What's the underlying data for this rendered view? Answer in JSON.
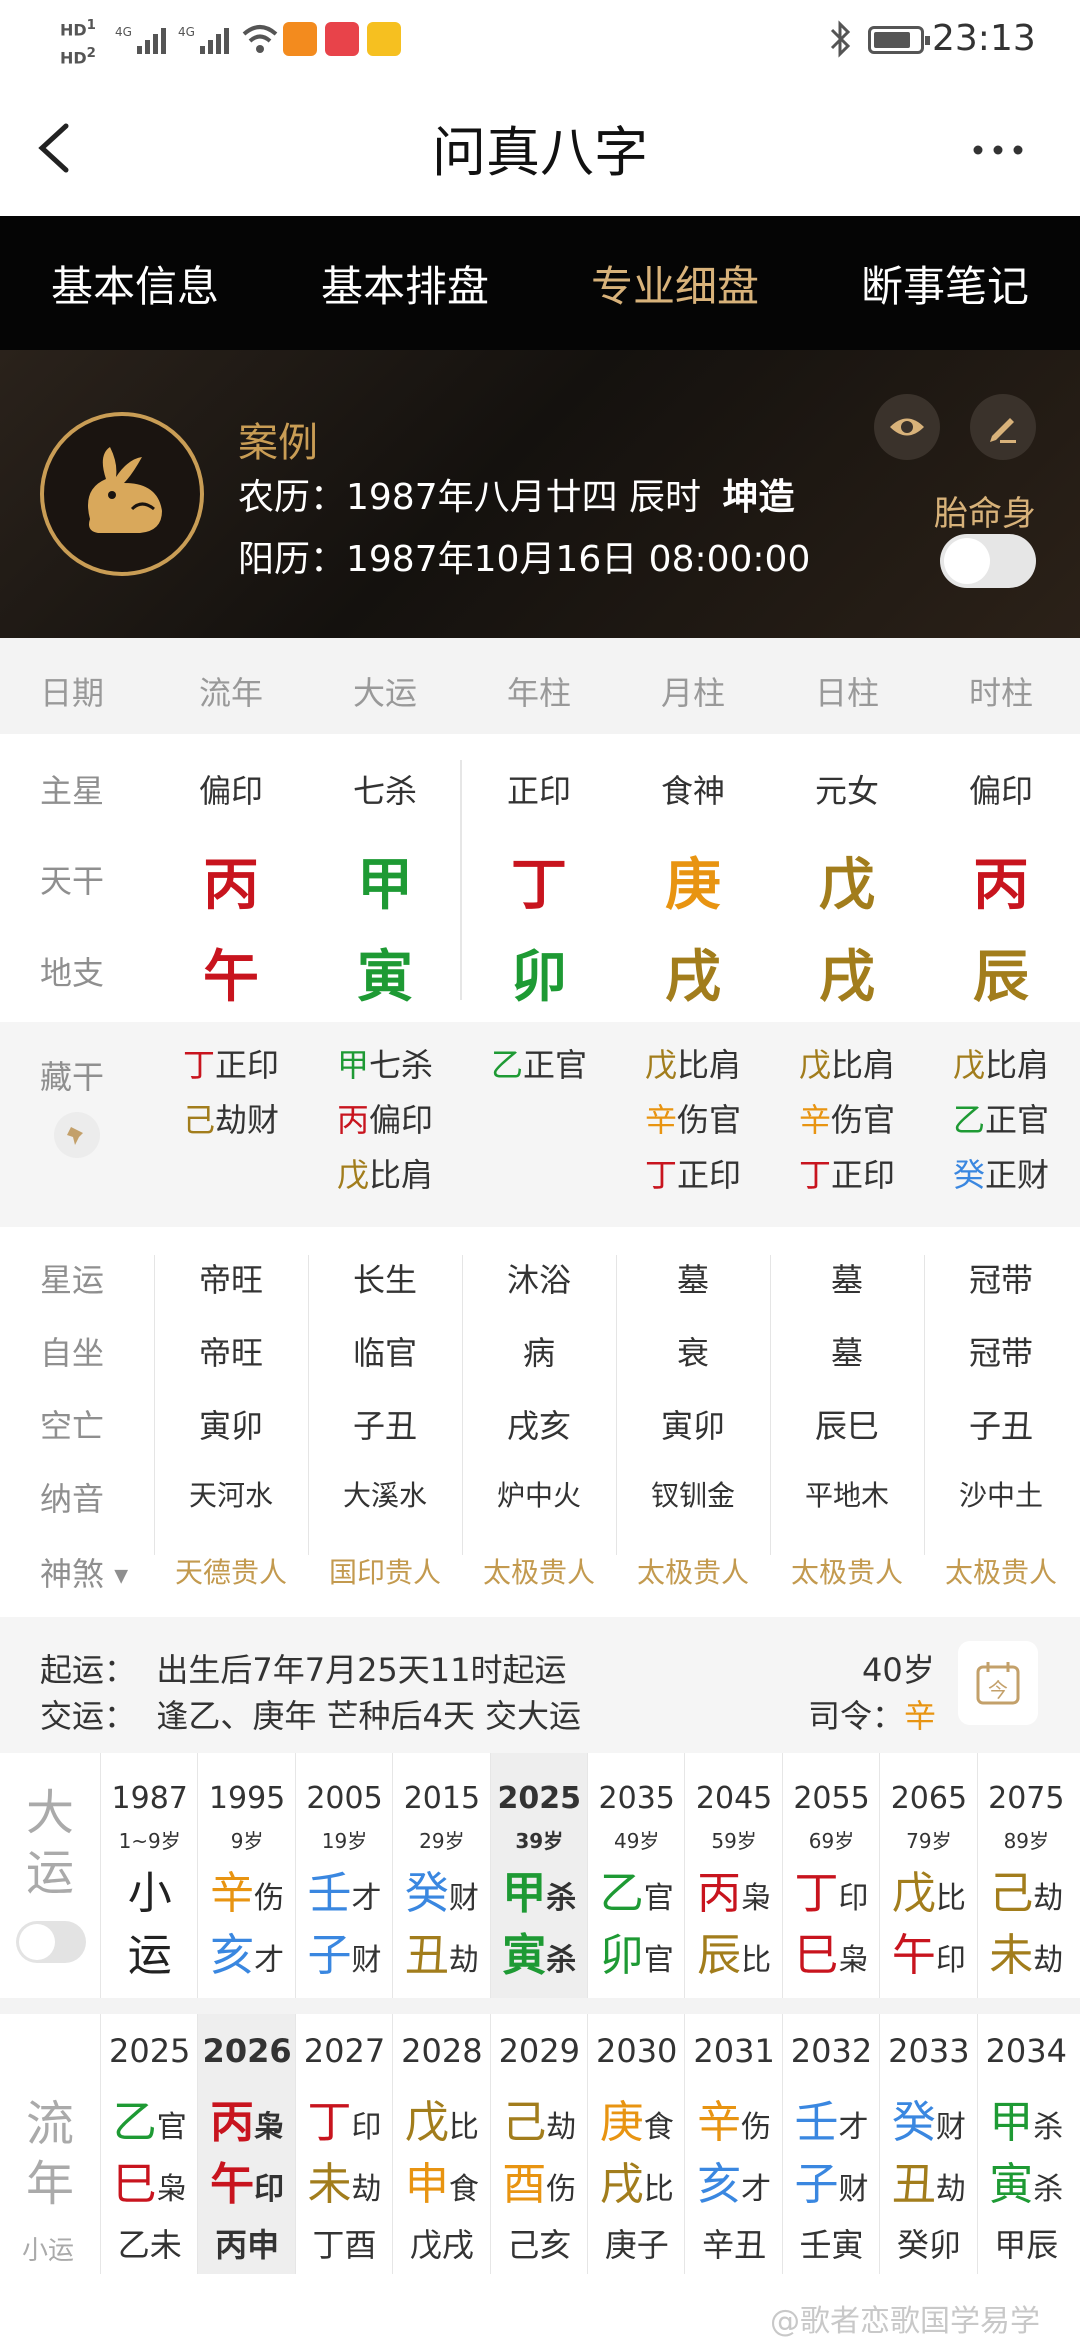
{
  "status_bar": {
    "left_text": "HD 4G 4G",
    "time": "23:13"
  },
  "header": {
    "title": "问真八字",
    "back_label": "<",
    "more_label": "···"
  },
  "tabs": [
    {
      "label": "基本信息"
    },
    {
      "label": "基本排盘"
    },
    {
      "label": "专业细盘",
      "active": true
    },
    {
      "label": "断事笔记"
    }
  ],
  "profile": {
    "name": "案例",
    "lunar_label": "农历：1987年八月廿四 辰时",
    "gender": "坤造",
    "solar_label": "阳历：1987年10月16日 08:00:00",
    "toggle_label": "胎命身"
  },
  "columns": {
    "header": [
      "日期",
      "流年",
      "大运",
      "年柱",
      "月柱",
      "日柱",
      "时柱"
    ]
  },
  "main_star": {
    "label": "主星",
    "values": [
      "偏印",
      "七杀",
      "正印",
      "食神",
      "元女",
      "偏印"
    ]
  },
  "tiangan": {
    "label": "天干",
    "values": [
      "丙",
      "甲",
      "丁",
      "庚",
      "戊",
      "丙"
    ],
    "colors": [
      "red",
      "green",
      "red",
      "orange",
      "gold",
      "red"
    ]
  },
  "dizhi": {
    "label": "地支",
    "values": [
      "午",
      "寅",
      "卯",
      "戌",
      "戌",
      "辰"
    ],
    "colors": [
      "red",
      "green",
      "green",
      "gold",
      "gold",
      "gold"
    ]
  },
  "canggan": {
    "label": "藏干",
    "cols": [
      [
        {
          "g": "丁",
          "c": "red",
          "t": "正印"
        },
        {
          "g": "己",
          "c": "gold",
          "t": "劫财"
        }
      ],
      [
        {
          "g": "甲",
          "c": "green",
          "t": "七杀"
        },
        {
          "g": "丙",
          "c": "red",
          "t": "偏印"
        },
        {
          "g": "戊",
          "c": "gold",
          "t": "比肩"
        }
      ],
      [
        {
          "g": "乙",
          "c": "green",
          "t": "正官"
        }
      ],
      [
        {
          "g": "戊",
          "c": "gold",
          "t": "比肩"
        },
        {
          "g": "辛",
          "c": "orange",
          "t": "伤官"
        },
        {
          "g": "丁",
          "c": "red",
          "t": "正印"
        }
      ],
      [
        {
          "g": "戊",
          "c": "gold",
          "t": "比肩"
        },
        {
          "g": "辛",
          "c": "orange",
          "t": "伤官"
        },
        {
          "g": "丁",
          "c": "red",
          "t": "正印"
        }
      ],
      [
        {
          "g": "戊",
          "c": "gold",
          "t": "比肩"
        },
        {
          "g": "乙",
          "c": "green",
          "t": "正官"
        },
        {
          "g": "癸",
          "c": "blue",
          "t": "正财"
        }
      ]
    ]
  },
  "info_rows": [
    {
      "label": "星运",
      "values": [
        "帝旺",
        "长生",
        "沐浴",
        "墓",
        "墓",
        "冠带"
      ]
    },
    {
      "label": "自坐",
      "values": [
        "帝旺",
        "临官",
        "病",
        "衰",
        "墓",
        "冠带"
      ]
    },
    {
      "label": "空亡",
      "values": [
        "寅卯",
        "子丑",
        "戌亥",
        "寅卯",
        "辰巳",
        "子丑"
      ]
    },
    {
      "label": "纳音",
      "values": [
        "天河水",
        "大溪水",
        "炉中火",
        "钗钏金",
        "平地木",
        "沙中土"
      ]
    }
  ],
  "shensha": {
    "label": "神煞",
    "values": [
      "天德贵人",
      "国印贵人",
      "太极贵人",
      "太极贵人",
      "太极贵人",
      "太极贵人"
    ]
  },
  "qiyun": {
    "start": "起运：  出生后7年7月25天11时起运",
    "jiao": "交运：  逢乙、庚年 芒种后4天 交大运",
    "age": "40岁",
    "siling_label": "司令：",
    "siling_value": "辛"
  },
  "dayun": {
    "label1": "大",
    "label2": "运",
    "items": [
      {
        "year": "1987",
        "age": "1~9岁",
        "g": "小",
        "gc": "dark",
        "gt": "",
        "z": "运",
        "zc": "dark",
        "zt": ""
      },
      {
        "year": "1995",
        "age": "9岁",
        "g": "辛",
        "gc": "orange",
        "gt": "伤",
        "z": "亥",
        "zc": "blue",
        "zt": "才"
      },
      {
        "year": "2005",
        "age": "19岁",
        "g": "壬",
        "gc": "blue",
        "gt": "才",
        "z": "子",
        "zc": "blue",
        "zt": "财"
      },
      {
        "year": "2015",
        "age": "29岁",
        "g": "癸",
        "gc": "blue",
        "gt": "财",
        "z": "丑",
        "zc": "gold",
        "zt": "劫"
      },
      {
        "year": "2025",
        "age": "39岁",
        "g": "甲",
        "gc": "green",
        "gt": "杀",
        "z": "寅",
        "zc": "green",
        "zt": "杀",
        "active": true
      },
      {
        "year": "2035",
        "age": "49岁",
        "g": "乙",
        "gc": "green",
        "gt": "官",
        "z": "卯",
        "zc": "green",
        "zt": "官"
      },
      {
        "year": "2045",
        "age": "59岁",
        "g": "丙",
        "gc": "red",
        "gt": "枭",
        "z": "辰",
        "zc": "gold",
        "zt": "比"
      },
      {
        "year": "2055",
        "age": "69岁",
        "g": "丁",
        "gc": "red",
        "gt": "印",
        "z": "巳",
        "zc": "red",
        "zt": "枭"
      },
      {
        "year": "2065",
        "age": "79岁",
        "g": "戊",
        "gc": "gold",
        "gt": "比",
        "z": "午",
        "zc": "red",
        "zt": "印"
      },
      {
        "year": "2075",
        "age": "89岁",
        "g": "己",
        "gc": "gold",
        "gt": "劫",
        "z": "未",
        "zc": "gold",
        "zt": "劫"
      }
    ]
  },
  "liunian": {
    "label1": "流",
    "label2": "年",
    "xiaoyun_label": "小运",
    "items": [
      {
        "year": "2025",
        "g": "乙",
        "gc": "green",
        "gt": "官",
        "z": "巳",
        "zc": "red",
        "zt": "枭",
        "xy": "乙未"
      },
      {
        "year": "2026",
        "g": "丙",
        "gc": "red",
        "gt": "枭",
        "z": "午",
        "zc": "red",
        "zt": "印",
        "xy": "丙申",
        "active": true
      },
      {
        "year": "2027",
        "g": "丁",
        "gc": "red",
        "gt": "印",
        "z": "未",
        "zc": "gold",
        "zt": "劫",
        "xy": "丁酉"
      },
      {
        "year": "2028",
        "g": "戊",
        "gc": "gold",
        "gt": "比",
        "z": "申",
        "zc": "orange",
        "zt": "食",
        "xy": "戊戌"
      },
      {
        "year": "2029",
        "g": "己",
        "gc": "gold",
        "gt": "劫",
        "z": "酉",
        "zc": "orange",
        "zt": "伤",
        "xy": "己亥"
      },
      {
        "year": "2030",
        "g": "庚",
        "gc": "orange",
        "gt": "食",
        "z": "戌",
        "zc": "gold",
        "zt": "比",
        "xy": "庚子"
      },
      {
        "year": "2031",
        "g": "辛",
        "gc": "orange",
        "gt": "伤",
        "z": "亥",
        "zc": "blue",
        "zt": "才",
        "xy": "辛丑"
      },
      {
        "year": "2032",
        "g": "壬",
        "gc": "blue",
        "gt": "才",
        "z": "子",
        "zc": "blue",
        "zt": "财",
        "xy": "壬寅"
      },
      {
        "year": "2033",
        "g": "癸",
        "gc": "blue",
        "gt": "财",
        "z": "丑",
        "zc": "gold",
        "zt": "劫",
        "xy": "癸卯"
      },
      {
        "year": "2034",
        "g": "甲",
        "gc": "green",
        "gt": "杀",
        "z": "寅",
        "zc": "green",
        "zt": "杀",
        "xy": "甲辰"
      }
    ]
  },
  "watermark": "@歌者恋歌国学易学",
  "colors": {
    "red": "#c8141e",
    "green": "#1e9a34",
    "gold": "#a27d1c",
    "orange": "#e89411",
    "blue": "#3a87e0",
    "tab_active": "#d8b27a"
  }
}
